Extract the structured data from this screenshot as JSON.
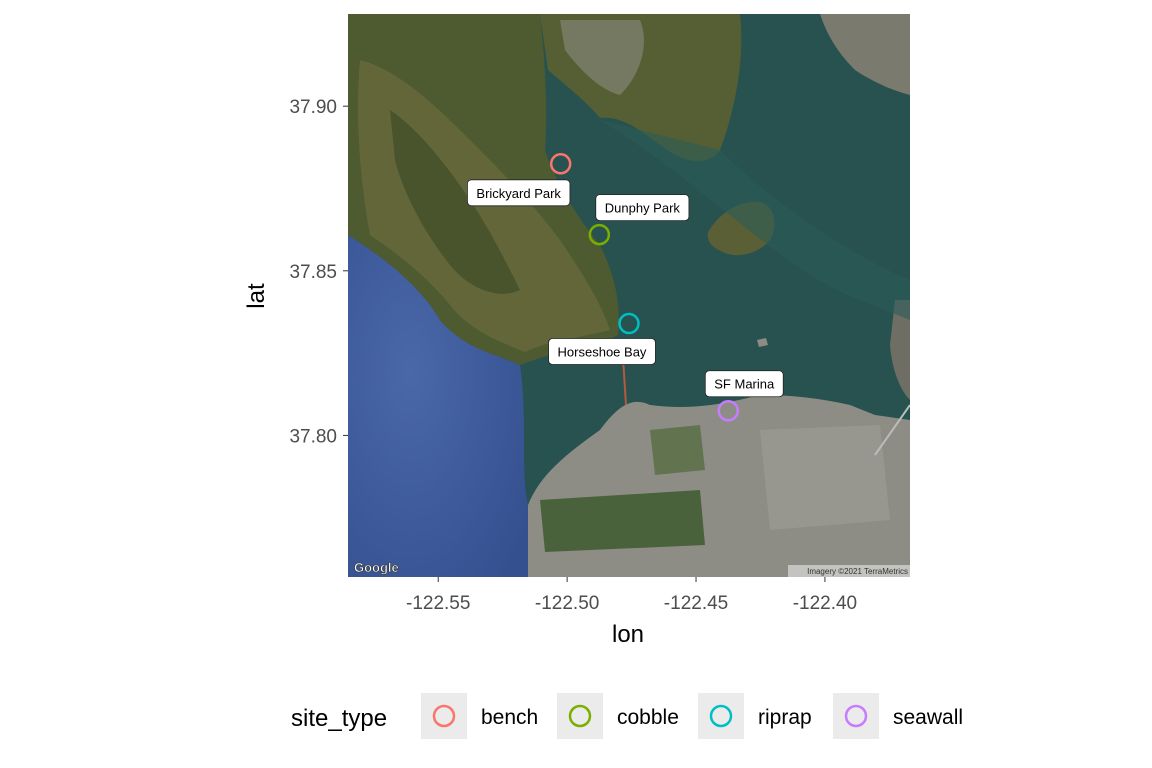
{
  "chart_data": {
    "type": "scatter",
    "basemap": "satellite",
    "xlabel": "lon",
    "ylabel": "lat",
    "xlim": [
      -122.585,
      -122.367
    ],
    "ylim": [
      37.757,
      37.928
    ],
    "xticks": [
      -122.55,
      -122.5,
      -122.45,
      -122.4
    ],
    "xtick_labels": [
      "-122.55",
      "-122.50",
      "-122.45",
      "-122.40"
    ],
    "yticks": [
      37.8,
      37.85,
      37.9
    ],
    "ytick_labels": [
      "37.80",
      "37.85",
      "37.90"
    ],
    "legend_title": "site_type",
    "legend_position": "bottom",
    "series": [
      {
        "name": "bench",
        "color": "#F8766D"
      },
      {
        "name": "cobble",
        "color": "#7CAE00"
      },
      {
        "name": "riprap",
        "color": "#00BFC4"
      },
      {
        "name": "seawall",
        "color": "#C77CFF"
      }
    ],
    "points": [
      {
        "label": "Brickyard Park",
        "site_type": "bench",
        "lon": -122.5025,
        "lat": 37.8825
      },
      {
        "label": "Dunphy Park",
        "site_type": "cobble",
        "lon": -122.4875,
        "lat": 37.861
      },
      {
        "label": "Horseshoe Bay",
        "site_type": "riprap",
        "lon": -122.476,
        "lat": 37.834
      },
      {
        "label": "SF Marina",
        "site_type": "seawall",
        "lon": -122.4375,
        "lat": 37.8075
      }
    ],
    "map_credits": {
      "logo": "Google",
      "imagery": "Imagery ©2021 TerraMetrics"
    }
  }
}
